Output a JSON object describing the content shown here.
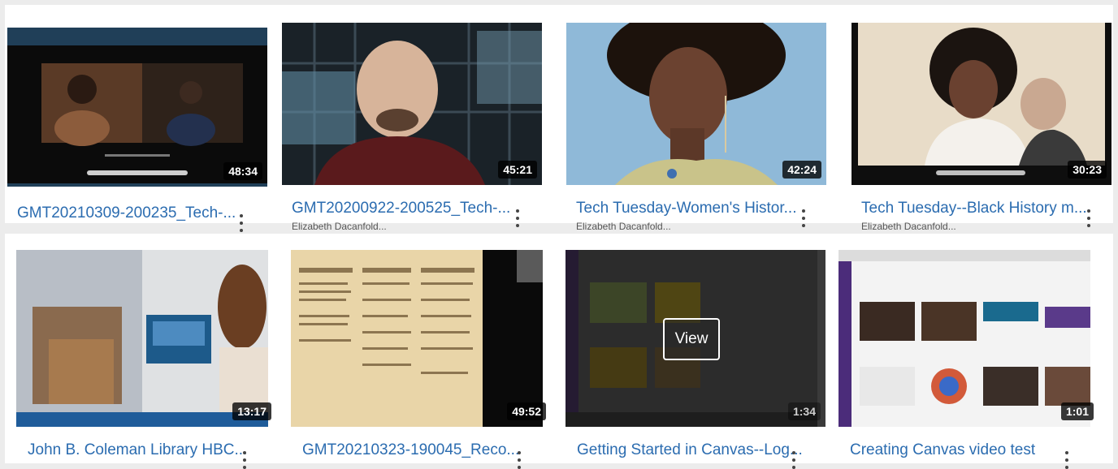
{
  "videos_row1": [
    {
      "title": "GMT20210309-200235_Tech-...",
      "author": "",
      "duration": "48:34"
    },
    {
      "title": "GMT20200922-200525_Tech-...",
      "author": "Elizabeth Dacanfold...",
      "duration": "45:21"
    },
    {
      "title": "Tech Tuesday-Women's Histor...",
      "author": "Elizabeth Dacanfold...",
      "duration": "42:24"
    },
    {
      "title": "Tech Tuesday--Black History m...",
      "author": "Elizabeth Dacanfold...",
      "duration": "30:23"
    }
  ],
  "videos_row2": [
    {
      "title": "John B. Coleman Library HBC...",
      "duration": "13:17"
    },
    {
      "title": "GMT20210323-190045_Reco...",
      "duration": "49:52"
    },
    {
      "title": "Getting Started in Canvas--Log...",
      "duration": "1:34",
      "hover_label": "View"
    },
    {
      "title": "Creating Canvas video test",
      "duration": "1:01"
    }
  ],
  "colors": {
    "title_link": "#2b6cb0",
    "background": "#ececec",
    "card": "#ffffff"
  }
}
